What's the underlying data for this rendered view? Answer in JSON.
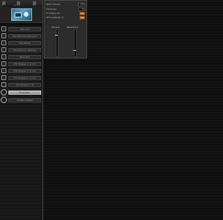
{
  "sidebar": {
    "top_icons": [
      {
        "icon": "device-icon",
        "label": "Inst"
      },
      {
        "icon": "flag-icon",
        "label": "Edit Load"
      },
      {
        "icon": "save-icon",
        "label": "Save"
      }
    ],
    "items": [
      {
        "label": "OSC Out",
        "icon": "oscillator-icon"
      },
      {
        "label": "OSC Filter Env/LFO Rout",
        "icon": "routing-icon"
      },
      {
        "label": "VCA Effects",
        "icon": "envelope-icon"
      },
      {
        "label": "Mod Source / Routing",
        "icon": "modulation-icon"
      },
      {
        "label": "Multi LFO",
        "icon": "lfo-icon"
      },
      {
        "label": "LFO Shapes 1 / 2 of 2",
        "icon": "filter-icon"
      },
      {
        "label": "LFO Shapes 3 / 4 of 2",
        "icon": "filter-icon"
      },
      {
        "label": "LFO Shapes 5 / 6 of 2",
        "icon": "filter-icon"
      },
      {
        "label": "LFO Shapes 7 / 8",
        "icon": "filter-icon"
      },
      {
        "label": "FX System",
        "icon": "globe-icon",
        "selected": true
      },
      {
        "label": "VP 8001 Master",
        "icon": "globe-icon"
      }
    ]
  },
  "panel": {
    "rows": [
      {
        "label": "Patch Volume",
        "value": "-Inf"
      },
      {
        "label": "Transpose",
        "value": "0"
      },
      {
        "label": "FX Engine On",
        "type": "button"
      },
      {
        "label": "Aft Sensitivity (?)",
        "type": "button"
      }
    ],
    "faders": [
      {
        "label": "Vol Out",
        "value": 0.82
      },
      {
        "label": "Resonance",
        "value": 0.2
      }
    ]
  },
  "colors": {
    "accent_orange": "#e08a35",
    "selected_item": "#a8a8a8",
    "background": "#121212"
  }
}
